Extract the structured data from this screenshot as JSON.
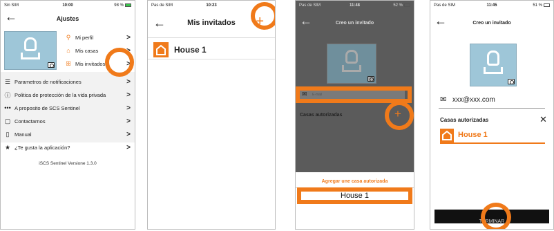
{
  "colors": {
    "accent": "#f07a1a",
    "avatar_bg": "#9ec6d8",
    "overlay": "#555555",
    "terminar_bar": "#111111"
  },
  "screen1": {
    "status": {
      "carrier": "Sin SIM",
      "time": "10:00",
      "battery": "98 %"
    },
    "title": "Ajustes",
    "profile_menu": [
      {
        "icon": "user-icon",
        "label": "Mi perfil"
      },
      {
        "icon": "house-outline-icon",
        "label": "Mis casas"
      },
      {
        "icon": "group-icon",
        "label": "Mis invitados"
      }
    ],
    "settings": [
      {
        "icon": "sliders-icon",
        "label": "Parametros de notificaciones"
      },
      {
        "icon": "info-icon",
        "label": "Politica de protección de la vida privada"
      },
      {
        "icon": "dots-icon",
        "label": "A proposito de SCS Sentinel"
      },
      {
        "icon": "chat-icon",
        "label": "Contactarnos"
      },
      {
        "icon": "document-icon",
        "label": "Manual"
      },
      {
        "icon": "star-icon",
        "label": "¿Te gusta la aplicación?"
      }
    ],
    "version": "iSCS Sentinel Versione 1.3.0"
  },
  "screen2": {
    "status": {
      "carrier": "Pas de SIM",
      "time": "10:23"
    },
    "title": "Mis invitados",
    "add_symbol": "+",
    "houses": [
      "House 1"
    ]
  },
  "screen3": {
    "status": {
      "carrier": "Pas de SIM",
      "time": "11:48",
      "battery": "52 %"
    },
    "title": "Creo un invitado",
    "email_placeholder": "E-mail",
    "authorized_label": "Casas autorizadas",
    "add_symbol": "+",
    "sheet_title": "Agregar une casa autorizada",
    "sheet_option": "House 1"
  },
  "screen4": {
    "status": {
      "carrier": "Pas de SIM",
      "time": "11:45",
      "battery": "51 %"
    },
    "title": "Creo un invitado",
    "email_value": "xxx@xxx.com",
    "authorized_label": "Casas autorizadas",
    "remove_symbol": "✕",
    "house": "House 1",
    "finish_label": "TERMINAR"
  }
}
